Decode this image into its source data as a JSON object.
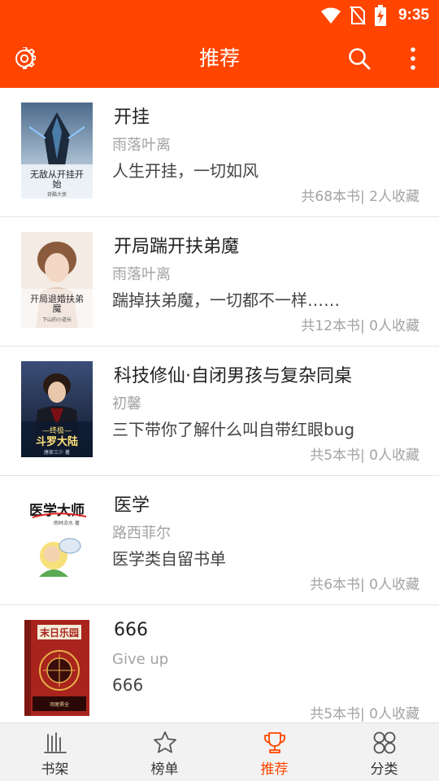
{
  "status": {
    "time": "9:35",
    "icons": [
      "wifi-icon",
      "no-sim-icon",
      "battery-charging-icon"
    ]
  },
  "app_bar": {
    "title": "推荐",
    "icons": [
      "gear-icon",
      "search-icon",
      "more-vert-icon"
    ]
  },
  "colors": {
    "accent": "#ff4500",
    "text_primary": "#222222",
    "text_secondary": "#a3a3a3",
    "nav_background": "#f2f2f2"
  },
  "books": [
    {
      "name": "开挂",
      "author": "雨落叶离",
      "desc": "人生开挂，一切如风",
      "count": "共68本书",
      "sep": "|",
      "likes": "2人收藏",
      "cover": {
        "lines": [
          "无敌从开挂开",
          "始"
        ],
        "sub": "奇酷大侠"
      }
    },
    {
      "name": "开局踹开扶弟魔",
      "author": "雨落叶离",
      "desc": "踹掉扶弟魔，一切都不一样……",
      "count": "共12本书",
      "sep": "|",
      "likes": "0人收藏",
      "cover": {
        "lines": [
          "开局退婚扶弟",
          "魔"
        ],
        "sub": "下山的小道长"
      }
    },
    {
      "name": "科技修仙·自闭男孩与复杂同桌",
      "author": "初馨",
      "desc": "三下带你了解什么叫自带红眼bug",
      "count": "共5本书",
      "sep": "|",
      "likes": "0人收藏",
      "cover": {
        "lines": [
          "—终极—",
          "斗罗大陆"
        ],
        "sub": "唐家三少 著"
      }
    },
    {
      "name": "医学",
      "author": "路西菲尔",
      "desc": "医学类自留书单",
      "count": "共6本书",
      "sep": "|",
      "likes": "0人收藏",
      "cover": {
        "lines": [
          "医学大师"
        ],
        "sub": "雨林流水 著"
      }
    },
    {
      "name": "666",
      "author": "Give up",
      "desc": "666",
      "count": "共5本书",
      "sep": "|",
      "likes": "0人收藏",
      "cover": {
        "lines": [
          "末日乐园"
        ],
        "sub": "须尾俱全"
      }
    }
  ],
  "bottom_nav": [
    {
      "label": "书架",
      "icon": "bookshelf-icon",
      "active": false
    },
    {
      "label": "榜单",
      "icon": "star-icon",
      "active": false
    },
    {
      "label": "推荐",
      "icon": "trophy-icon",
      "active": true
    },
    {
      "label": "分类",
      "icon": "category-grid-icon",
      "active": false
    }
  ]
}
